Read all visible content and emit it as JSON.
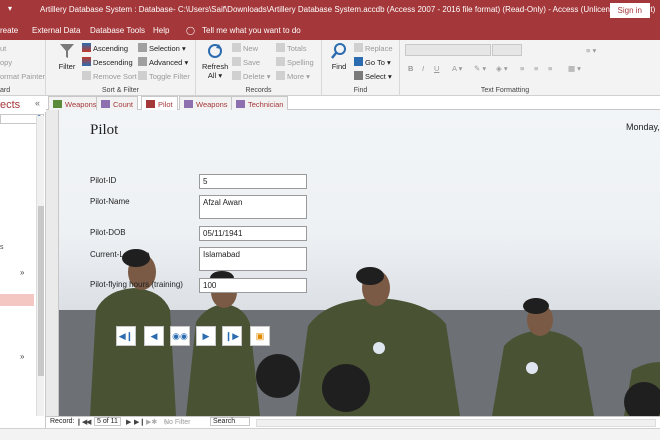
{
  "window": {
    "title": "Artillery Database System : Database- C:\\Users\\Saif\\Downloads\\Artillery Database System.accdb (Access 2007 - 2016 file format) (Read-Only)  -  Access (Unlicensed Product)",
    "sign_in": "Sign in"
  },
  "menu": {
    "create": "reate",
    "external": "External Data",
    "tools": "Database Tools",
    "help": "Help",
    "tell_me": "Tell me what you want to do"
  },
  "ribbon": {
    "clipboard": {
      "cut": "ut",
      "copy": "opy",
      "painter": "ormat Painter",
      "label": "ard"
    },
    "sort_filter": {
      "filter": "Filter",
      "ascending": "Ascending",
      "descending": "Descending",
      "remove_sort": "Remove Sort",
      "selection": "Selection",
      "advanced": "Advanced",
      "toggle_filter": "Toggle Filter",
      "label": "Sort & Filter"
    },
    "records": {
      "refresh": "Refresh",
      "all": "All",
      "new": "New",
      "save": "Save",
      "delete": "Delete",
      "totals": "Totals",
      "spelling": "Spelling",
      "more": "More",
      "label": "Records"
    },
    "find": {
      "find": "Find",
      "replace": "Replace",
      "goto": "Go To",
      "select": "Select",
      "label": "Find"
    },
    "text_formatting": {
      "label": "Text Formatting"
    }
  },
  "nav_pane": {
    "title": "ects"
  },
  "tabs": [
    {
      "label": "Weapons"
    },
    {
      "label": "Count"
    },
    {
      "label": "Pilot"
    },
    {
      "label": "Weapons"
    },
    {
      "label": "Technician"
    }
  ],
  "form": {
    "title": "Pilot",
    "date": "Monday,",
    "fields": [
      {
        "label": "Pilot-ID",
        "value": "5"
      },
      {
        "label": "Pilot-Name",
        "value": "Afzal Awan"
      },
      {
        "label": "Pilot-DOB",
        "value": "05/11/1941"
      },
      {
        "label": "Current-Location",
        "value": "Islamabad"
      },
      {
        "label": "Pilot-flying hours (training)",
        "value": "100"
      }
    ]
  },
  "status": {
    "record_label": "Record:",
    "record_pos": "5 of 11",
    "no_filter": "No Filter",
    "search": "Search"
  },
  "colors": {
    "accent": "#a4373a",
    "ribbon_bg": "#f3f3f3"
  }
}
